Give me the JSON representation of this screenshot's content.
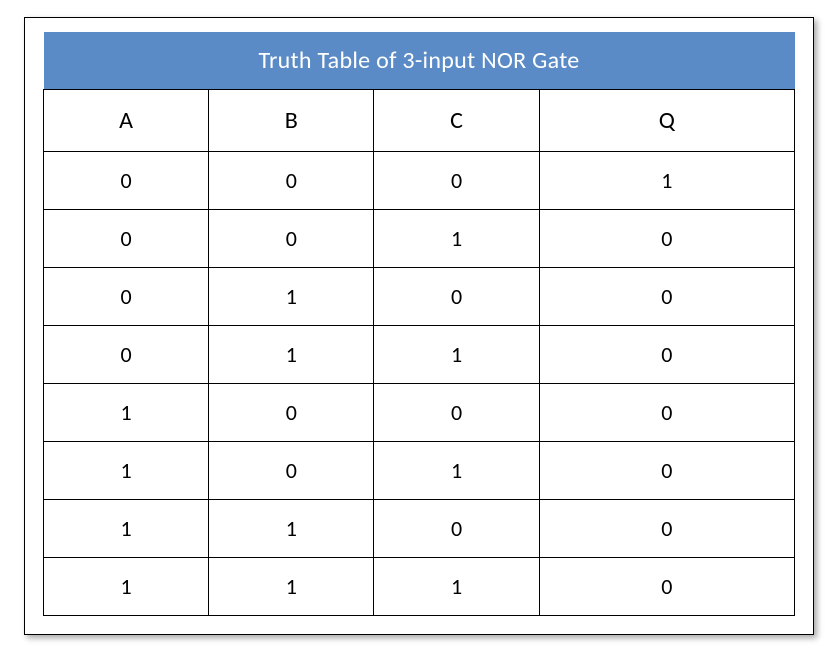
{
  "chart_data": {
    "type": "table",
    "title": "Truth Table of 3-input NOR Gate",
    "columns": [
      "A",
      "B",
      "C",
      "Q"
    ],
    "rows": [
      [
        "0",
        "0",
        "0",
        "1"
      ],
      [
        "0",
        "0",
        "1",
        "0"
      ],
      [
        "0",
        "1",
        "0",
        "0"
      ],
      [
        "0",
        "1",
        "1",
        "0"
      ],
      [
        "1",
        "0",
        "0",
        "0"
      ],
      [
        "1",
        "0",
        "1",
        "0"
      ],
      [
        "1",
        "1",
        "0",
        "0"
      ],
      [
        "1",
        "1",
        "1",
        "0"
      ]
    ]
  }
}
